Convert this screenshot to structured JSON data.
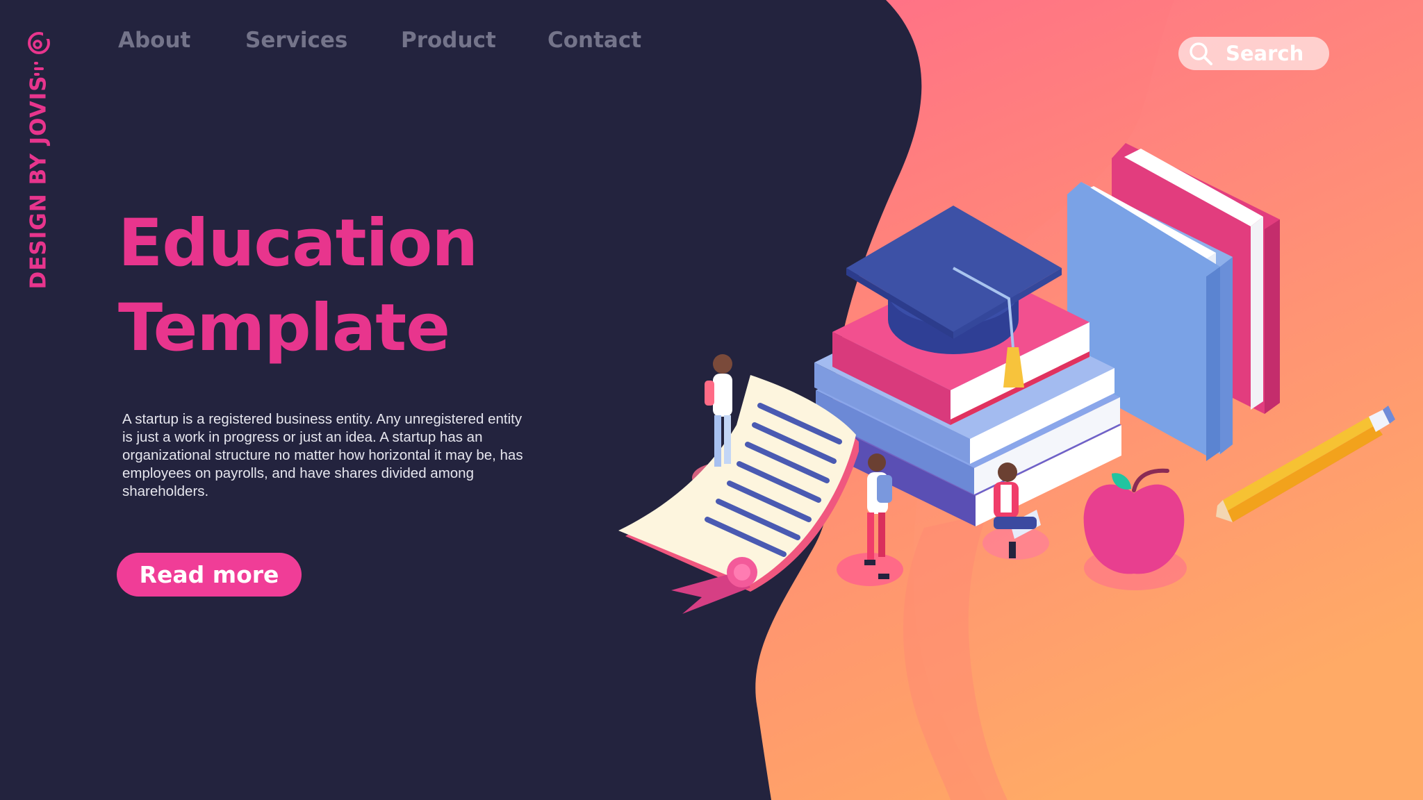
{
  "brand": {
    "name": "DESIGN BY JOVIS",
    "logo_icon": "target-logo-icon"
  },
  "nav": {
    "items": [
      {
        "label": "About"
      },
      {
        "label": "Services"
      },
      {
        "label": "Product"
      },
      {
        "label": "Contact"
      }
    ]
  },
  "search": {
    "label": "Search",
    "icon": "search-icon"
  },
  "hero": {
    "title_line1": "Education",
    "title_line2": "Template",
    "body": "A startup is a registered business entity. Any unregistered entity is just a work in progress or just an idea. A startup has an organizational structure no matter how horizontal it may be, has employees on payrolls, and have shares divided among shareholders.",
    "cta_label": "Read more"
  },
  "colors": {
    "background": "#23233e",
    "accent_pink": "#e8358d",
    "nav_text": "#74748a",
    "wave_gradient_top": "#ff6f88",
    "wave_gradient_bottom": "#ffa765"
  }
}
